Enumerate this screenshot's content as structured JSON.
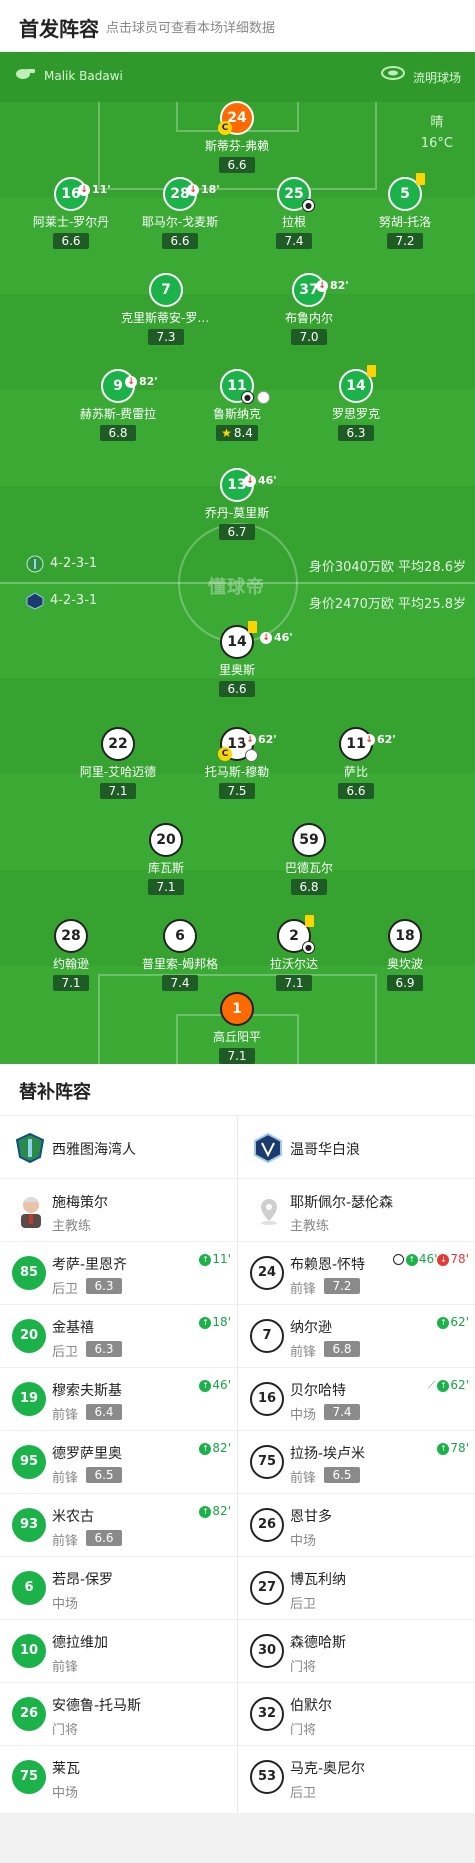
{
  "header": {
    "title": "首发阵容",
    "hint": "点击球员可查看本场详细数据"
  },
  "match_info": {
    "referee": "Malik Badawi",
    "venue": "流明球场",
    "weather": "晴",
    "temperature": "16°C",
    "watermark": "懂球帝"
  },
  "home_team": {
    "name": "西雅图海湾人",
    "formation": "4-2-3-1",
    "value_text": "身价3040万欧 平均28.6岁",
    "coach": {
      "name": "施梅策尔",
      "role": "主教练"
    },
    "lineup": [
      {
        "num": "24",
        "name": "斯蒂芬-弗赖",
        "rating": "6.6",
        "gk": true,
        "captain": true
      },
      {
        "num": "16",
        "name": "阿莱士-罗尔丹",
        "rating": "6.6",
        "sub_out": "11'"
      },
      {
        "num": "28",
        "name": "耶马尔-戈麦斯",
        "rating": "6.6",
        "sub_out": "18'"
      },
      {
        "num": "25",
        "name": "拉根",
        "rating": "7.4",
        "goal": true
      },
      {
        "num": "5",
        "name": "努胡-托洛",
        "rating": "7.2",
        "yellow": true
      },
      {
        "num": "7",
        "name": "克里斯蒂安-罗尔丹",
        "rating": "7.3"
      },
      {
        "num": "37",
        "name": "布鲁内尔",
        "rating": "7.0",
        "sub_out": "82'"
      },
      {
        "num": "9",
        "name": "赫苏斯-费雷拉",
        "rating": "6.8",
        "sub_out": "82'"
      },
      {
        "num": "11",
        "name": "鲁斯纳克",
        "rating": "8.4",
        "star": true,
        "goal": true,
        "assist": true
      },
      {
        "num": "14",
        "name": "罗思罗克",
        "rating": "6.3",
        "yellow": true
      },
      {
        "num": "13",
        "name": "乔丹-莫里斯",
        "rating": "6.7",
        "sub_out": "46'"
      }
    ]
  },
  "away_team": {
    "name": "温哥华白浪",
    "formation": "4-2-3-1",
    "value_text": "身价2470万欧 平均25.8岁",
    "coach": {
      "name": "耶斯佩尔-瑟伦森",
      "role": "主教练"
    },
    "lineup": [
      {
        "num": "14",
        "name": "里奥斯",
        "rating": "6.6",
        "yellow": true,
        "sub_out": "46'"
      },
      {
        "num": "22",
        "name": "阿里-艾哈迈德",
        "rating": "7.1"
      },
      {
        "num": "13",
        "name": "托马斯-穆勒",
        "rating": "7.5",
        "captain": true,
        "sub_out": "62'",
        "assist": true
      },
      {
        "num": "11",
        "name": "萨比",
        "rating": "6.6",
        "sub_out": "62'"
      },
      {
        "num": "20",
        "name": "库瓦斯",
        "rating": "7.1"
      },
      {
        "num": "59",
        "name": "巴德瓦尔",
        "rating": "6.8"
      },
      {
        "num": "28",
        "name": "约翰逊",
        "rating": "7.1"
      },
      {
        "num": "6",
        "name": "普里索-姆邦格",
        "rating": "7.4"
      },
      {
        "num": "2",
        "name": "拉沃尔达",
        "rating": "7.1",
        "yellow": true,
        "goal": true
      },
      {
        "num": "18",
        "name": "奥坎波",
        "rating": "6.9"
      },
      {
        "num": "1",
        "name": "高丘阳平",
        "rating": "7.1",
        "gk": true
      }
    ]
  },
  "subs": {
    "title": "替补阵容",
    "home": [
      {
        "num": "85",
        "name": "考萨-里恩齐",
        "pos": "后卫",
        "rating": "6.3",
        "event": "11'"
      },
      {
        "num": "20",
        "name": "金基禧",
        "pos": "后卫",
        "rating": "6.3",
        "event": "18'"
      },
      {
        "num": "19",
        "name": "穆索夫斯基",
        "pos": "前锋",
        "rating": "6.4",
        "event": "46'"
      },
      {
        "num": "95",
        "name": "德罗萨里奥",
        "pos": "前锋",
        "rating": "6.5",
        "event": "82'"
      },
      {
        "num": "93",
        "name": "米农古",
        "pos": "前锋",
        "rating": "6.6",
        "event": "82'"
      },
      {
        "num": "6",
        "name": "若昂-保罗",
        "pos": "中场"
      },
      {
        "num": "10",
        "name": "德拉维加",
        "pos": "前锋"
      },
      {
        "num": "26",
        "name": "安德鲁-托马斯",
        "pos": "门将"
      },
      {
        "num": "75",
        "name": "莱瓦",
        "pos": "中场"
      }
    ],
    "away": [
      {
        "num": "24",
        "name": "布赖恩-怀特",
        "pos": "前锋",
        "rating": "7.2",
        "event": "46'",
        "event_out": "78'",
        "goal": true
      },
      {
        "num": "7",
        "name": "纳尔逊",
        "pos": "前锋",
        "rating": "6.8",
        "event": "62'"
      },
      {
        "num": "16",
        "name": "贝尔哈特",
        "pos": "中场",
        "rating": "7.4",
        "event": "62'",
        "assist": true
      },
      {
        "num": "75",
        "name": "拉扬-埃卢米",
        "pos": "前锋",
        "rating": "6.5",
        "event": "78'"
      },
      {
        "num": "26",
        "name": "恩甘多",
        "pos": "中场"
      },
      {
        "num": "27",
        "name": "博瓦利纳",
        "pos": "后卫"
      },
      {
        "num": "30",
        "name": "森德哈斯",
        "pos": "门将"
      },
      {
        "num": "32",
        "name": "伯默尔",
        "pos": "门将"
      },
      {
        "num": "53",
        "name": "马克-奥尼尔",
        "pos": "后卫"
      }
    ]
  },
  "colors": {
    "pitch": "#3aaa35",
    "home": "#1bb24a",
    "gk": "#ff6a00",
    "yellow": "#ffd400",
    "sub_out": "#e53935"
  },
  "icons": [
    "whistle-icon",
    "stadium-icon",
    "goal-ball-icon",
    "sub-in-icon",
    "sub-out-icon",
    "yellow-card-icon",
    "captain-icon",
    "star-icon"
  ]
}
